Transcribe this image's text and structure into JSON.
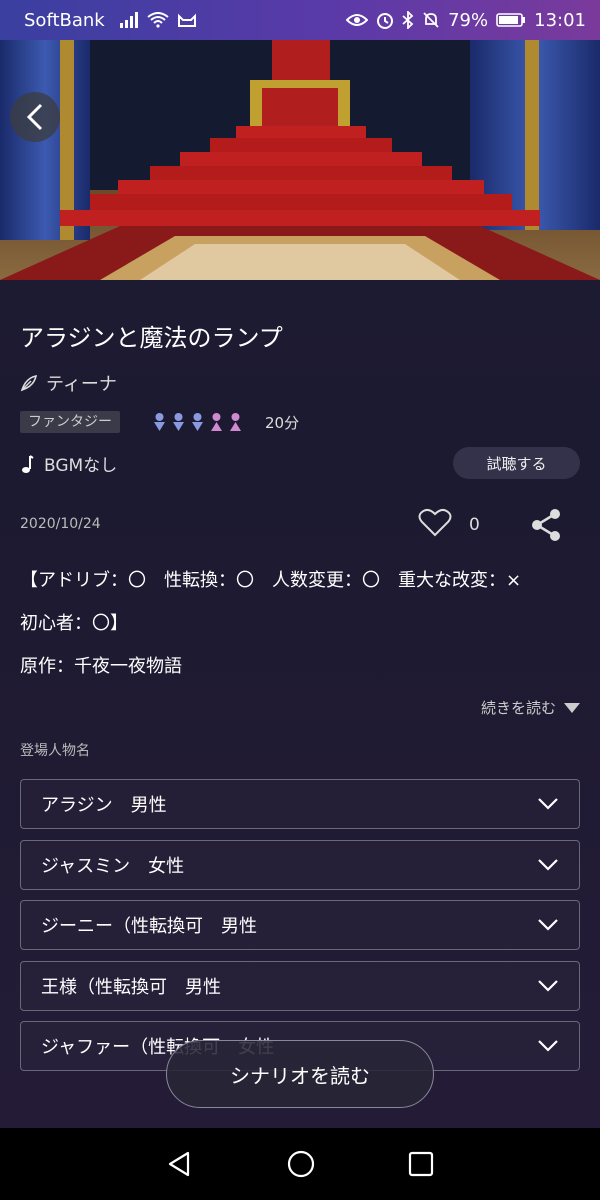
{
  "status_bar": {
    "carrier": "SoftBank",
    "battery": "79%",
    "time": "13:01",
    "icons": [
      "signal-icon",
      "wifi-icon",
      "cat-icon",
      "eye-icon",
      "alarm-icon",
      "bluetooth-icon",
      "mute-icon",
      "battery-icon"
    ]
  },
  "header": {
    "back_icon": "chevron-left-icon"
  },
  "story": {
    "title": "アラジンと魔法のランプ",
    "author": "ティーナ",
    "genre": "ファンタジー",
    "duration": "20分",
    "cast_icons": {
      "male": 3,
      "female": 2
    },
    "bgm": "BGMなし",
    "listen_label": "試聴する",
    "date": "2020/10/24",
    "likes": "0",
    "description": [
      "【アドリブ：〇　性転換：〇　人数変更：〇　重大な改変：×",
      "初心者：〇】",
      "原作：千夜一夜物語"
    ],
    "read_more": "続きを読む"
  },
  "characters": {
    "label": "登場人物名",
    "items": [
      "アラジン　男性",
      "ジャスミン　女性",
      "ジーニー（性転換可　男性",
      "王様（性転換可　男性",
      "ジャファー（性転換可　女性"
    ]
  },
  "read_button": "シナリオを読む",
  "colors": {
    "male": "#8a9ae0",
    "female": "#d08ad0",
    "accent": "#34324a"
  }
}
